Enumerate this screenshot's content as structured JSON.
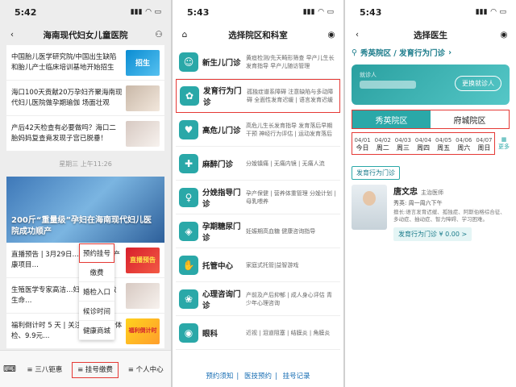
{
  "panel1": {
    "time": "5:42",
    "title": "海南现代妇女儿童医院",
    "news_top": [
      {
        "text": "中国胎儿医学研究院/中国出生缺陷和胎儿产士临床培训基地开始招生",
        "badge": "招生"
      },
      {
        "text": "海口100天贡献20万孕妇齐聚海南现代妇儿医院做孕期瑜伽 场面壮观",
        "badge": ""
      },
      {
        "text": "产后42天检查有必要做吗？海口二胎妈妈复查竟发现子宫已脱垂！",
        "badge": ""
      }
    ],
    "timestamp": "星期三 上午11:26",
    "hero_caption": "200斤“重量级”孕妇在海南现代妇儿医院成功顺产",
    "news_bottom": [
      {
        "text": "直播预告 | 3月29日…热辣来袭，产康项目…",
        "badge": "直播预告"
      },
      {
        "text": "生殖医学专家高洁…妇儿 用爱播撒生命…",
        "badge": ""
      },
      {
        "text": "福利倒计时 5 天 | 关注…10，5折体检、9.9元…",
        "badge": "福利倒计时"
      }
    ],
    "popup_menu": [
      "预约挂号",
      "缴费",
      "婚检入口",
      "候诊时间",
      "健康商城"
    ],
    "tabs": [
      "三八钜惠",
      "挂号缴费",
      "个人中心"
    ]
  },
  "panel2": {
    "time": "5:43",
    "title": "选择院区和科室",
    "departments": [
      {
        "name": "新生儿门诊",
        "desc": "黄疸检测/先天畸形筛查 早产儿生长发育指导 早产儿随访管理",
        "icon": "baby-icon"
      },
      {
        "name": "发育行为门诊",
        "desc": "孤独症谱系障碍 注意缺陷与多动障碍 全面性发育迟缓 | 语言发育迟缓",
        "icon": "development-icon"
      },
      {
        "name": "高危儿门诊",
        "desc": "高危儿生长发育指导 发育落后早期干预 神经行为评估 | 运动发育落后",
        "icon": "highrisk-icon"
      },
      {
        "name": "麻醉门诊",
        "desc": "分娩镇痛 | 无痛内镜 | 无痛人流",
        "icon": "anesthesia-icon"
      },
      {
        "name": "分娩指导门诊",
        "desc": "孕产保健 | 营养体重管理 分娩计划 | 母乳喂养",
        "icon": "delivery-icon"
      },
      {
        "name": "孕期糖尿门诊",
        "desc": "妊娠期高血糖 健康咨询指导",
        "icon": "diabetes-icon"
      },
      {
        "name": "托管中心",
        "desc": "家庭式托管|益智游戏",
        "icon": "care-icon"
      },
      {
        "name": "心理咨询门诊",
        "desc": "产前及产后抑郁 | 成人身心评估 青少年心理咨询",
        "icon": "psych-icon"
      },
      {
        "name": "眼科",
        "desc": "近视 | 泪道阻塞 | 结膜炎 | 角膜炎",
        "icon": "eye-icon"
      }
    ],
    "footer_links": [
      "预约须知",
      "医技预约",
      "挂号记录"
    ]
  },
  "panel3": {
    "time": "5:43",
    "title": "选择医生",
    "location": "秀英院区 / 发育行为门诊",
    "patient_label": "就诊人",
    "switch_label": "更换就诊人",
    "campuses": [
      "秀英院区",
      "府城院区"
    ],
    "dates": [
      {
        "date": "04/01",
        "day": "今日"
      },
      {
        "date": "04/02",
        "day": "周二"
      },
      {
        "date": "04/03",
        "day": "周三"
      },
      {
        "date": "04/04",
        "day": "周四"
      },
      {
        "date": "04/05",
        "day": "周五"
      },
      {
        "date": "04/06",
        "day": "周六"
      },
      {
        "date": "04/07",
        "day": "周日"
      }
    ],
    "more_label": "更多",
    "dept_tag": "发育行为门诊",
    "doctor": {
      "name": "唐文忠",
      "title": "主治医师",
      "schedule": "秀英: 周一周六下午",
      "skill": "擅长:语言发育迟缓、孤独症、阿斯伯格综合征、多动症、抽动症、智力障碍、学习困难。",
      "fee": "发育行为门诊 ¥ 0.00 >"
    }
  }
}
